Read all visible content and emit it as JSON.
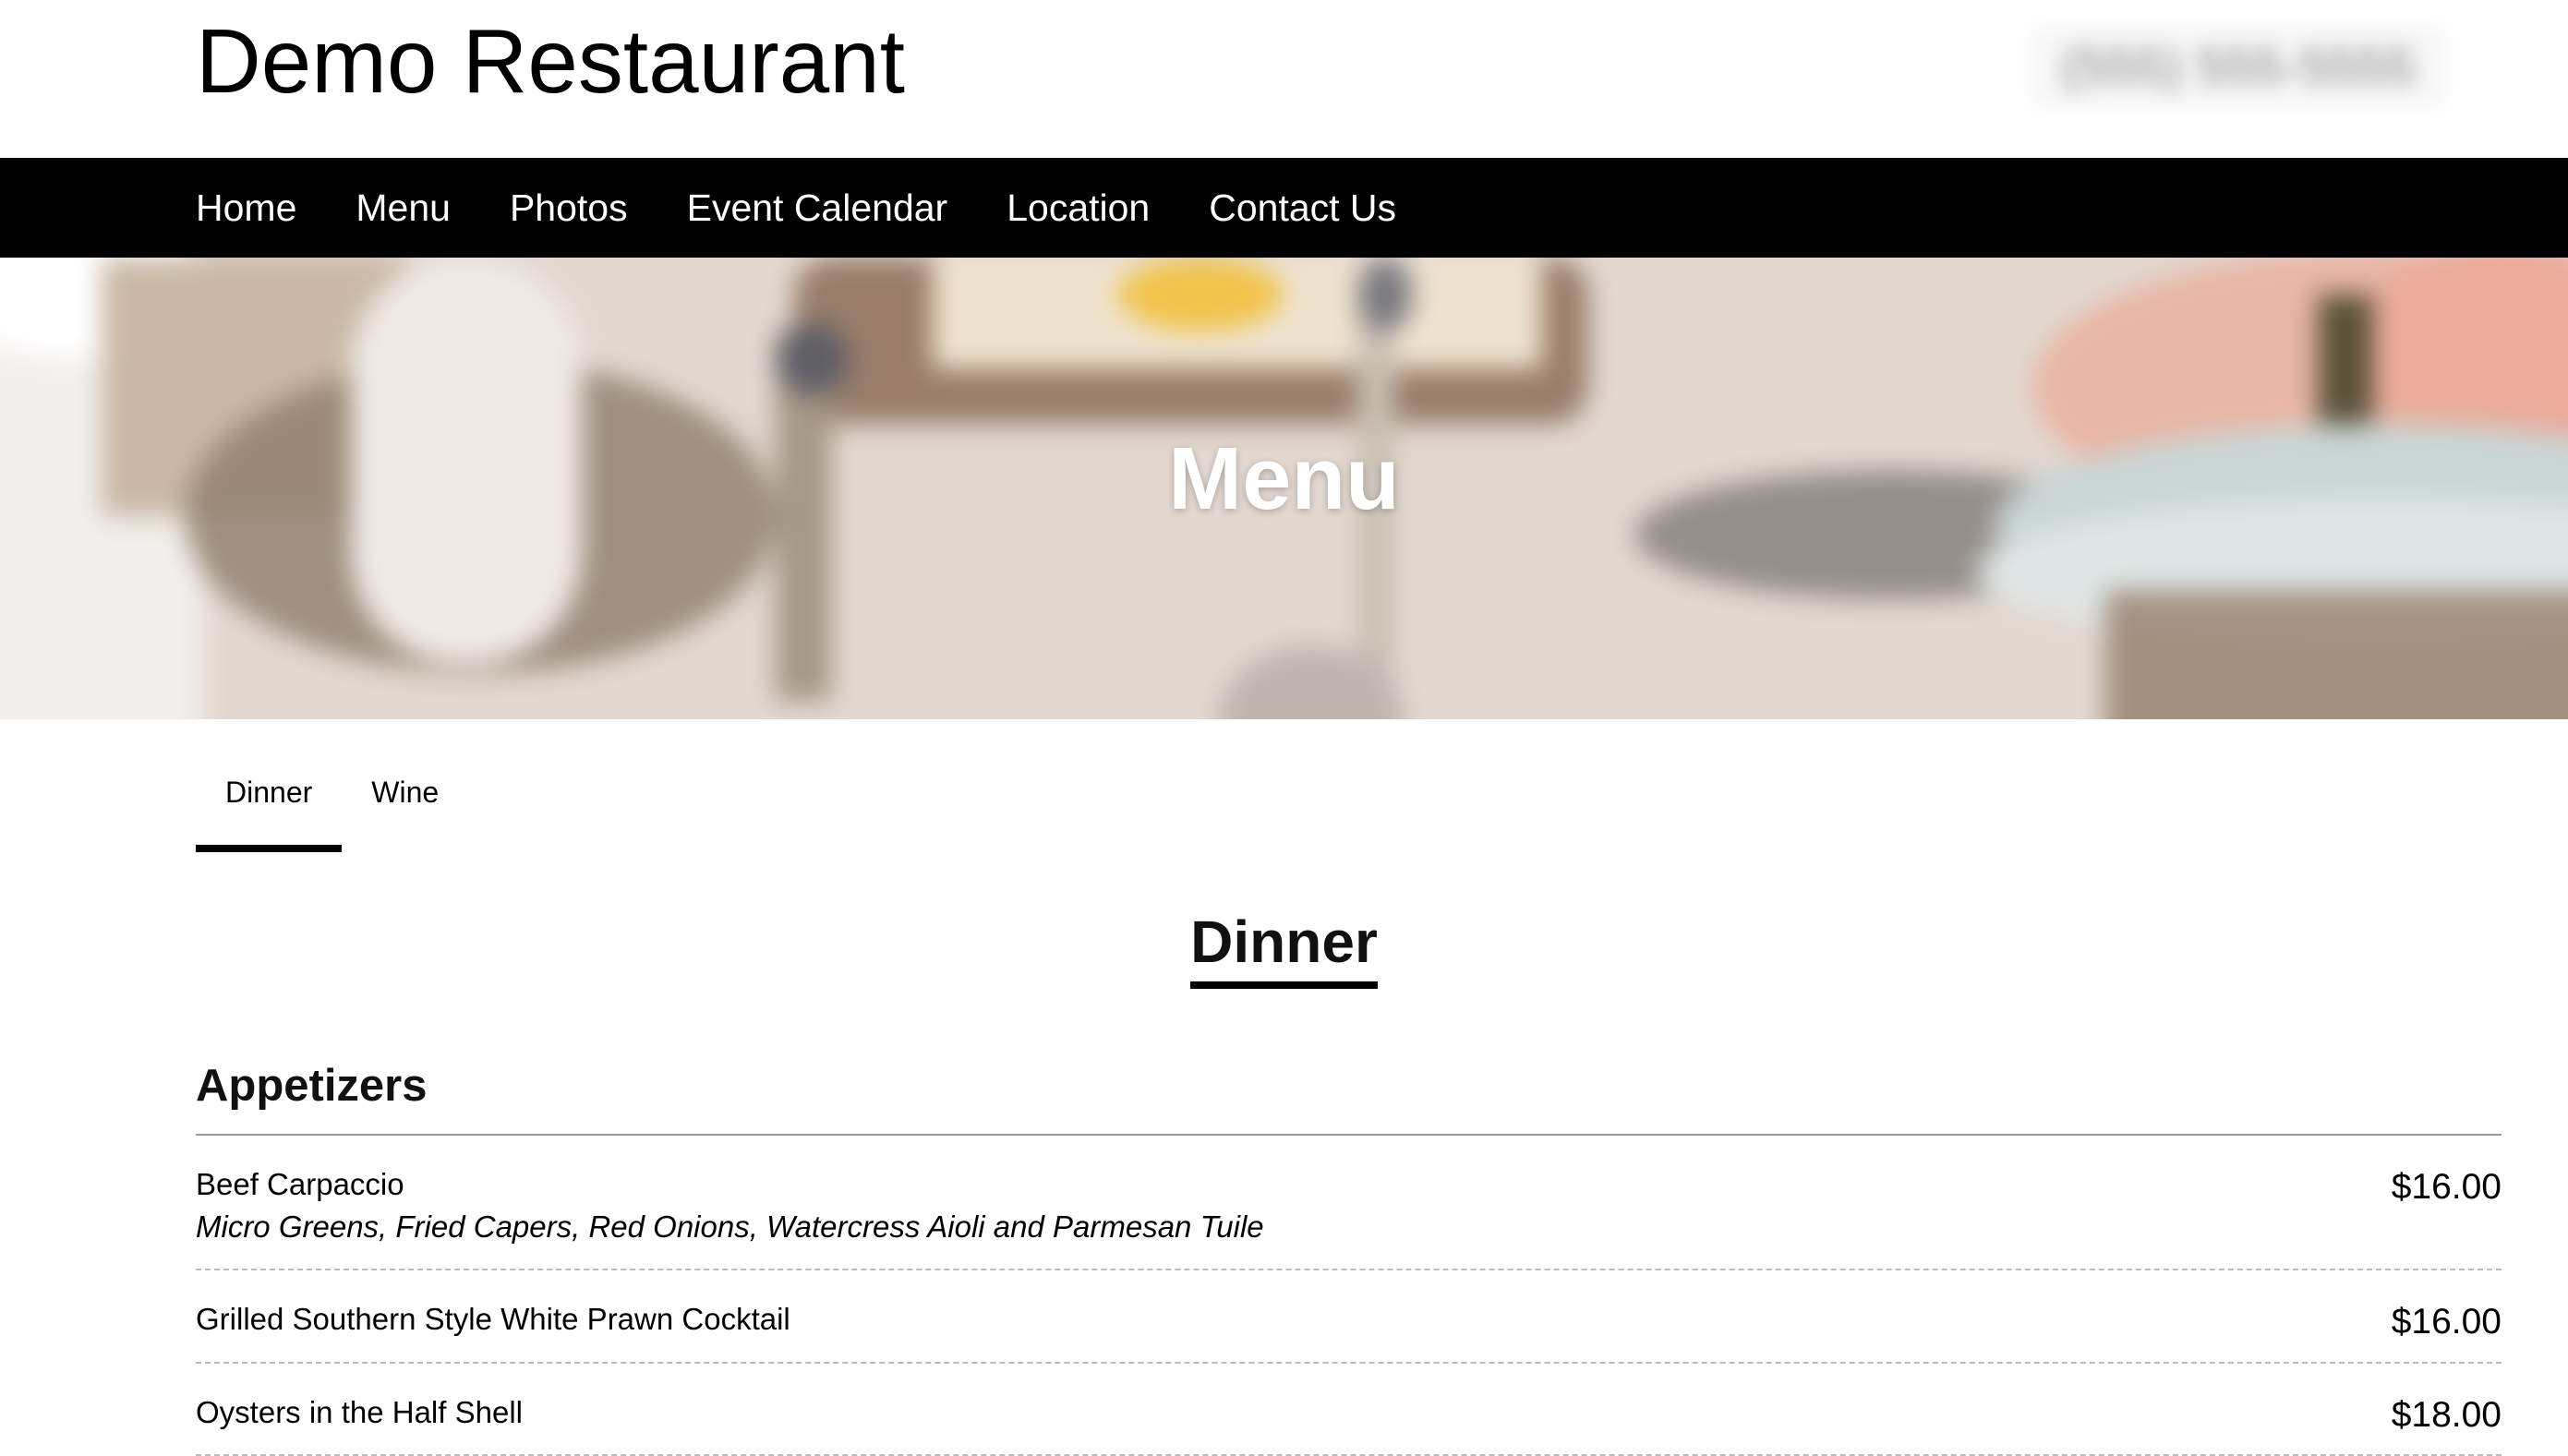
{
  "header": {
    "site_title": "Demo Restaurant",
    "phone": "(555) 555-5555"
  },
  "nav": {
    "items": [
      {
        "label": "Home"
      },
      {
        "label": "Menu"
      },
      {
        "label": "Photos"
      },
      {
        "label": "Event Calendar"
      },
      {
        "label": "Location"
      },
      {
        "label": "Contact Us"
      }
    ]
  },
  "hero": {
    "title": "Menu"
  },
  "menu_tabs": {
    "items": [
      {
        "label": "Dinner",
        "active": true
      },
      {
        "label": "Wine",
        "active": false
      }
    ]
  },
  "section": {
    "title": "Dinner"
  },
  "category": {
    "title": "Appetizers",
    "items": [
      {
        "name": "Beef Carpaccio",
        "description": "Micro Greens, Fried Capers, Red Onions, Watercress Aioli and Parmesan Tuile",
        "price": "$16.00"
      },
      {
        "name": "Grilled Southern Style White Prawn Cocktail",
        "description": "",
        "price": "$16.00"
      },
      {
        "name": "Oysters in the Half Shell",
        "description": "",
        "price": "$18.00"
      }
    ]
  }
}
